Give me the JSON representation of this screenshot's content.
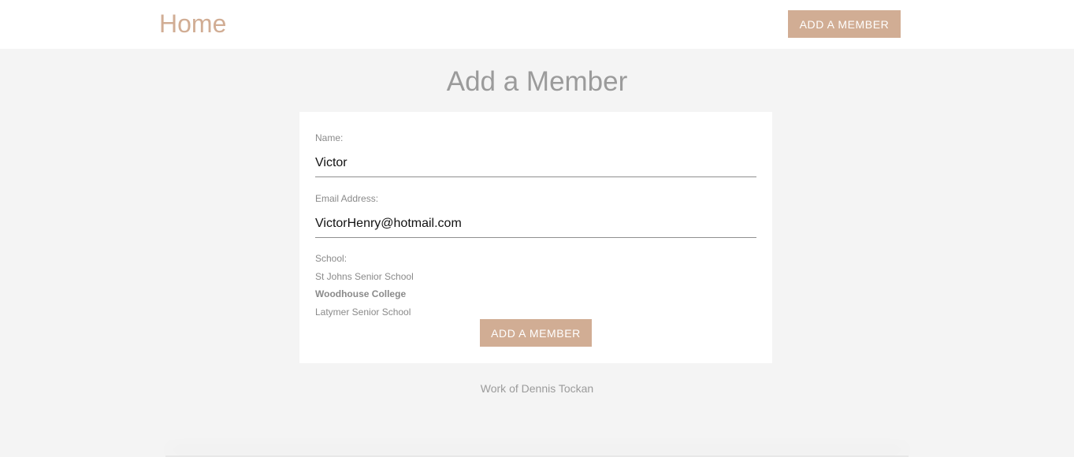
{
  "navbar": {
    "brand": "Home",
    "add_button_label": "ADD A MEMBER"
  },
  "page_title": "Add a Member",
  "form": {
    "name_label": "Name:",
    "name_value": "Victor",
    "email_label": "Email Address:",
    "email_value": "VictorHenry@hotmail.com",
    "school_label": "School:",
    "school_options": [
      {
        "label": "St Johns Senior School",
        "selected": false
      },
      {
        "label": "Woodhouse College",
        "selected": true
      },
      {
        "label": "Latymer Senior School",
        "selected": false
      }
    ],
    "submit_label": "ADD A MEMBER"
  },
  "footer": "Work of Dennis Tockan",
  "colors": {
    "accent": "#d1ad94",
    "page_background": "#f4f4f4",
    "card_background": "#ffffff",
    "muted_text": "#9b9b9b"
  }
}
